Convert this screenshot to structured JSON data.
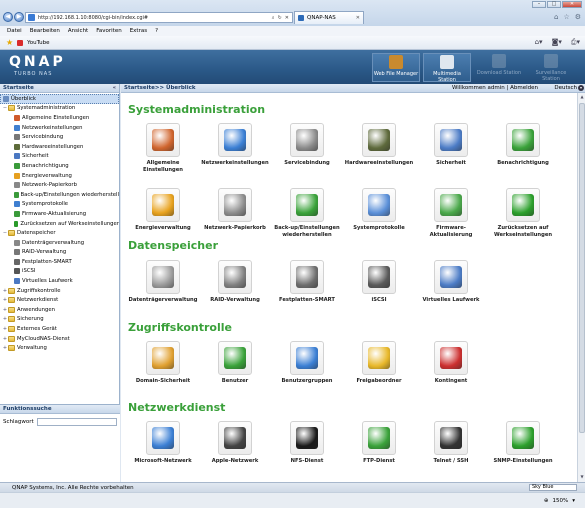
{
  "browser": {
    "url": "http://192.168.1.10:8080/cgi-bin/index.cgi#",
    "tab_title": "QNAP-NAS",
    "menu": [
      "Datei",
      "Bearbeiten",
      "Ansicht",
      "Favoriten",
      "Extras",
      "?"
    ],
    "favorite": "YouTube",
    "zoom": "150%"
  },
  "header": {
    "logo": "QNAP",
    "logo_sub": "TURBO NAS",
    "buttons": [
      {
        "label": "Web File Manager",
        "enabled": true,
        "color": "#c98a2e"
      },
      {
        "label": "Multimedia Station",
        "enabled": true,
        "color": "#2b4f86"
      },
      {
        "label": "Download Station",
        "enabled": false,
        "color": "#8fa4ba"
      },
      {
        "label": "Surveillance Station",
        "enabled": false,
        "color": "#8fa4ba"
      }
    ]
  },
  "sidebar": {
    "title": "Startseite",
    "items": [
      {
        "label": "Überblick",
        "level": 0,
        "type": "page",
        "selected": true,
        "color": "#6a8dbf"
      },
      {
        "label": "Systemadministration",
        "level": 0,
        "type": "folder",
        "tw": "−"
      },
      {
        "label": "Allgemeine Einstellungen",
        "level": 1,
        "type": "page",
        "color": "#d05a2a"
      },
      {
        "label": "Netzwerkeinstellungen",
        "level": 1,
        "type": "page",
        "color": "#3f7fd0"
      },
      {
        "label": "Servicebindung",
        "level": 1,
        "type": "page",
        "color": "#777"
      },
      {
        "label": "Hardwareeinstellungen",
        "level": 1,
        "type": "page",
        "color": "#5d6b3a"
      },
      {
        "label": "Sicherheit",
        "level": 1,
        "type": "page",
        "color": "#4a78c2"
      },
      {
        "label": "Benachrichtigung",
        "level": 1,
        "type": "page",
        "color": "#3a9a3a"
      },
      {
        "label": "Energieverwaltung",
        "level": 1,
        "type": "page",
        "color": "#e6a020"
      },
      {
        "label": "Netzwerk-Papierkorb",
        "level": 1,
        "type": "page",
        "color": "#888"
      },
      {
        "label": "Back-up/Einstellungen wiederherstell",
        "level": 1,
        "type": "page",
        "color": "#3a9a3a"
      },
      {
        "label": "Systemprotokolle",
        "level": 1,
        "type": "page",
        "color": "#3f7fd0"
      },
      {
        "label": "Firmware-Aktualisierung",
        "level": 1,
        "type": "page",
        "color": "#3a9a3a"
      },
      {
        "label": "Zurücksetzen auf Werkseinstellunger",
        "level": 1,
        "type": "page",
        "color": "#2a9a2a"
      },
      {
        "label": "Datenspeicher",
        "level": 0,
        "type": "folder",
        "tw": "−"
      },
      {
        "label": "Datenträgerverwaltung",
        "level": 1,
        "type": "page",
        "color": "#888"
      },
      {
        "label": "RAID-Verwaltung",
        "level": 1,
        "type": "page",
        "color": "#777"
      },
      {
        "label": "Festplatten-SMART",
        "level": 1,
        "type": "page",
        "color": "#666"
      },
      {
        "label": "iSCSI",
        "level": 1,
        "type": "page",
        "color": "#555"
      },
      {
        "label": "Virtuelles Laufwerk",
        "level": 1,
        "type": "page",
        "color": "#4a78c2"
      },
      {
        "label": "Zugriffskontrolle",
        "level": 0,
        "type": "folder",
        "tw": "+"
      },
      {
        "label": "Netzwerkdienst",
        "level": 0,
        "type": "folder",
        "tw": "+"
      },
      {
        "label": "Anwendungen",
        "level": 0,
        "type": "folder",
        "tw": "+"
      },
      {
        "label": "Sicherung",
        "level": 0,
        "type": "folder",
        "tw": "+"
      },
      {
        "label": "Externes Gerät",
        "level": 0,
        "type": "folder",
        "tw": "+"
      },
      {
        "label": "MyCloudNAS-Dienst",
        "level": 0,
        "type": "folder",
        "tw": "+"
      },
      {
        "label": "Verwaltung",
        "level": 0,
        "type": "folder",
        "tw": "+"
      }
    ]
  },
  "function_search": {
    "title": "Funktionssuche",
    "label": "Schlagwort",
    "value": ""
  },
  "main": {
    "breadcrumb": "Startseite>> Überblick",
    "welcome": "Willkommen admin | Abmelden",
    "language": "Deutsch",
    "sections": [
      {
        "title": "Systemadministration",
        "items": [
          {
            "label": "Allgemeine Einstellungen",
            "color": "#d0652e"
          },
          {
            "label": "Netzwerkeinstellungen",
            "color": "#3b7fd4"
          },
          {
            "label": "Servicebindung",
            "color": "#8a8a8a"
          },
          {
            "label": "Hardwareeinstellungen",
            "color": "#5e6a3c"
          },
          {
            "label": "Sicherheit",
            "color": "#4c7cc6"
          },
          {
            "label": "Benachrichtigung",
            "color": "#3aa23a"
          },
          {
            "label": "Energieverwaltung",
            "color": "#e8a21e"
          },
          {
            "label": "Netzwerk-Papierkorb",
            "color": "#8c8c8c"
          },
          {
            "label": "Back-up/Einstellungen wiederherstellen",
            "color": "#3aa23a"
          },
          {
            "label": "Systemprotokolle",
            "color": "#5a8fd8"
          },
          {
            "label": "Firmware-Aktualisierung",
            "color": "#4aa84a"
          },
          {
            "label": "Zurücksetzen auf Werkseinstellungen",
            "color": "#2ca02c"
          }
        ]
      },
      {
        "title": "Datenspeicher",
        "items": [
          {
            "label": "Datenträgerverwaltung",
            "color": "#9a9a9a"
          },
          {
            "label": "RAID-Verwaltung",
            "color": "#808080"
          },
          {
            "label": "Festplatten-SMART",
            "color": "#6e6e6e"
          },
          {
            "label": "iSCSI",
            "color": "#5a5a5a"
          },
          {
            "label": "Virtuelles Laufwerk",
            "color": "#4c7cc6"
          }
        ]
      },
      {
        "title": "Zugriffskontrolle",
        "items": [
          {
            "label": "Domain-Sicherheit",
            "color": "#e0a030"
          },
          {
            "label": "Benutzer",
            "color": "#3aa23a"
          },
          {
            "label": "Benutzergruppen",
            "color": "#3b7fd4"
          },
          {
            "label": "Freigabeordner",
            "color": "#e8b82a"
          },
          {
            "label": "Kontingent",
            "color": "#cc3030"
          }
        ]
      },
      {
        "title": "Netzwerkdienst",
        "items": [
          {
            "label": "Microsoft-Netzwerk",
            "color": "#3b7fd4"
          },
          {
            "label": "Apple-Netzwerk",
            "color": "#444444"
          },
          {
            "label": "NFS-Dienst",
            "color": "#1a1a1a"
          },
          {
            "label": "FTP-Dienst",
            "color": "#3aa23a"
          },
          {
            "label": "Telnet / SSH",
            "color": "#333333"
          },
          {
            "label": "SNMP-Einstellungen",
            "color": "#2ca02c"
          }
        ]
      }
    ]
  },
  "footer": {
    "copyright": "QNAP Systems, Inc. Alle Rechte vorbehalten",
    "theme": "Sky Blue"
  }
}
